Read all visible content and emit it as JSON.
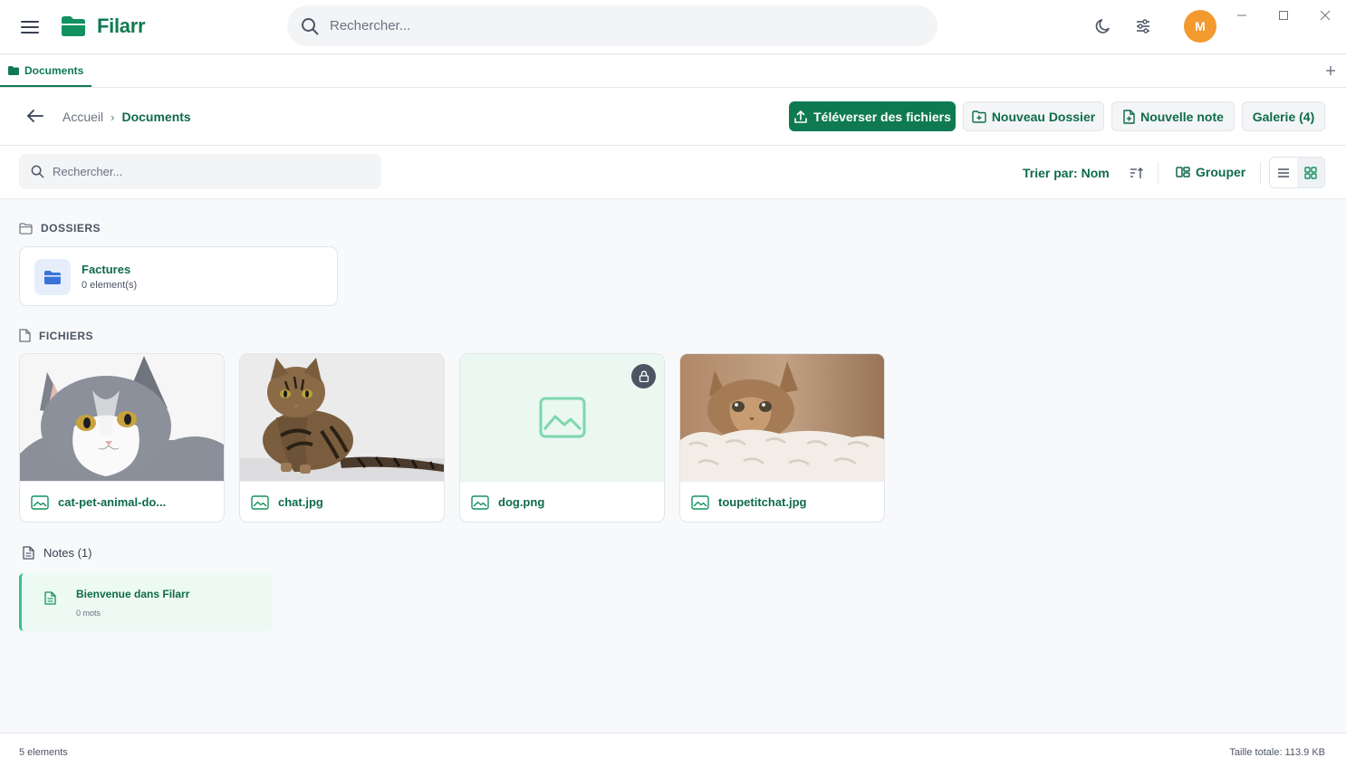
{
  "app": {
    "name": "Filarr"
  },
  "top_search": {
    "placeholder": "Rechercher..."
  },
  "user": {
    "initial": "M",
    "avatar_color": "#f29a2e"
  },
  "tabs": [
    {
      "label": "Documents"
    }
  ],
  "breadcrumb": {
    "home": "Accueil",
    "separator": "›",
    "current": "Documents"
  },
  "actions": {
    "upload": "Téléverser des fichiers",
    "new_folder": "Nouveau Dossier",
    "new_note": "Nouvelle note",
    "gallery": "Galerie (4)"
  },
  "filter": {
    "search_placeholder": "Rechercher...",
    "sort_label": "Trier par: Nom",
    "group_label": "Grouper"
  },
  "sections": {
    "folders": "DOSSIERS",
    "files": "FICHIERS",
    "notes": "Notes (1)"
  },
  "folders": [
    {
      "name": "Factures",
      "count": "0 element(s)"
    }
  ],
  "files": [
    {
      "name": "cat-pet-animal-do...",
      "thumb": "cat-gray-white-photo",
      "locked": false
    },
    {
      "name": "chat.jpg",
      "thumb": "tabby-cat-photo",
      "locked": false
    },
    {
      "name": "dog.png",
      "thumb": "image-placeholder-icon",
      "locked": true
    },
    {
      "name": "toupetitchat.jpg",
      "thumb": "kitten-blanket-photo",
      "locked": false
    }
  ],
  "notes": [
    {
      "title": "Bienvenue dans Filarr",
      "words": "0 mots"
    }
  ],
  "status": {
    "count": "5 elements",
    "total_size": "Taille totale: 113.9 KB"
  },
  "colors": {
    "brand": "#0f7a52",
    "accent": "#34c38f",
    "folder_blue": "#3b74d9"
  }
}
